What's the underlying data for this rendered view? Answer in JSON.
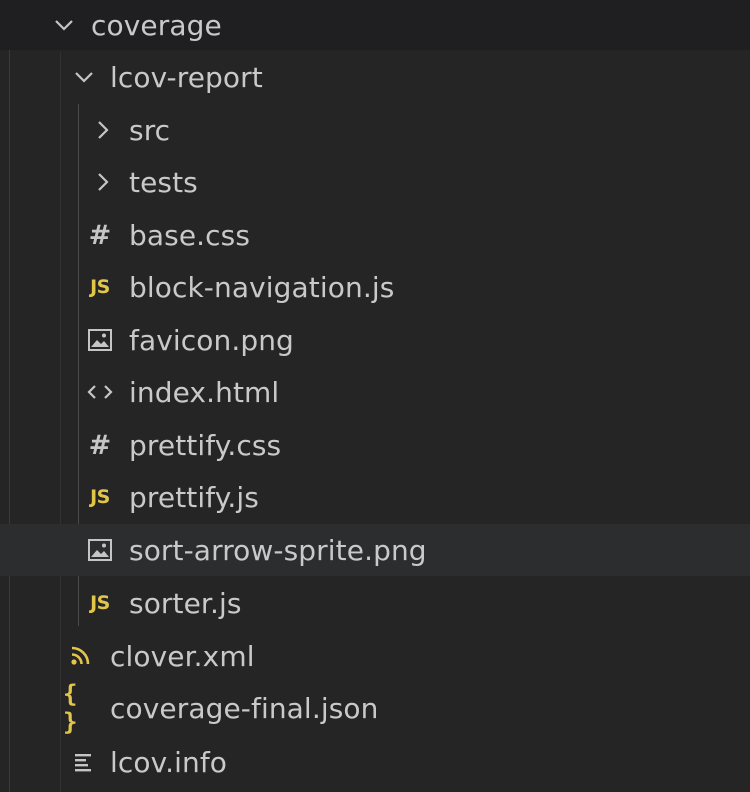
{
  "explorer": {
    "coverage": {
      "label": "coverage",
      "icon": "chevron-down-icon"
    },
    "lcov_report": {
      "label": "lcov-report",
      "icon": "chevron-down-icon"
    },
    "lcov_children": [
      {
        "label": "src",
        "icon": "chevron-right-icon",
        "type": "folder"
      },
      {
        "label": "tests",
        "icon": "chevron-right-icon",
        "type": "folder"
      },
      {
        "label": "base.css",
        "icon": "css-hash-icon",
        "type": "file"
      },
      {
        "label": "block-navigation.js",
        "icon": "js-file-icon",
        "type": "file"
      },
      {
        "label": "favicon.png",
        "icon": "image-file-icon",
        "type": "file"
      },
      {
        "label": "index.html",
        "icon": "html-code-icon",
        "type": "file"
      },
      {
        "label": "prettify.css",
        "icon": "css-hash-icon",
        "type": "file"
      },
      {
        "label": "prettify.js",
        "icon": "js-file-icon",
        "type": "file"
      },
      {
        "label": "sort-arrow-sprite.png",
        "icon": "image-file-icon",
        "type": "file",
        "hovered": true
      },
      {
        "label": "sorter.js",
        "icon": "js-file-icon",
        "type": "file"
      }
    ],
    "coverage_files": [
      {
        "label": "clover.xml",
        "icon": "rss-xml-icon"
      },
      {
        "label": "coverage-final.json",
        "icon": "json-braces-icon"
      },
      {
        "label": "lcov.info",
        "icon": "text-lines-icon"
      }
    ],
    "glyphs": {
      "js": "JS",
      "hash": "#",
      "braces": "{ }"
    },
    "colors": {
      "background": "#252526",
      "text": "#c9c9c9",
      "js_yellow": "#e2c64a",
      "hover_row": "#2c2d2f",
      "guide": "#4a4a4a"
    }
  }
}
